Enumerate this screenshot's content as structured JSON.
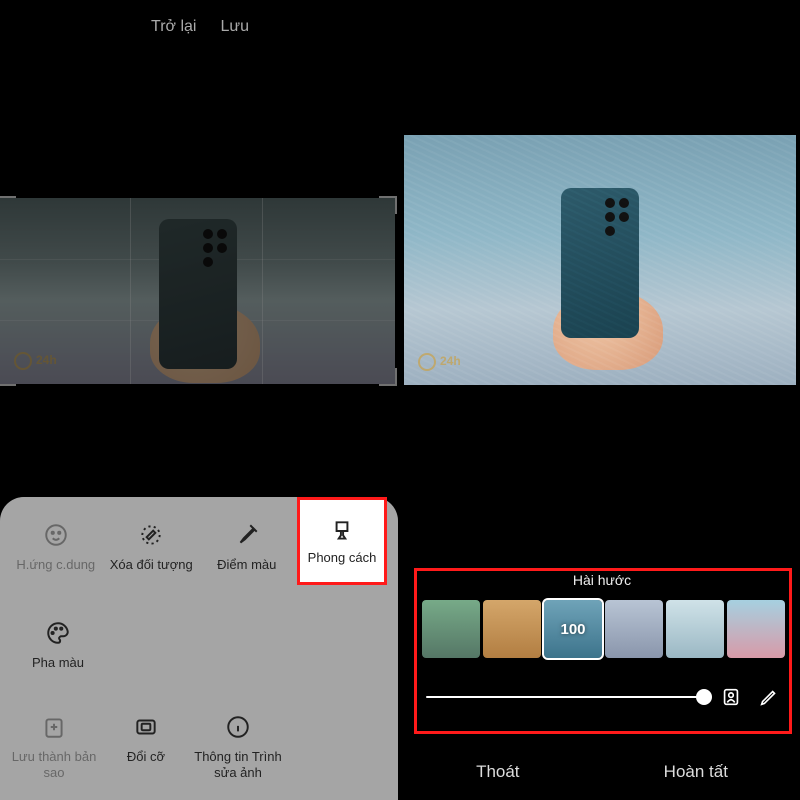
{
  "top": {
    "back": "Trở lại",
    "save": "Lưu"
  },
  "watermark": "24h",
  "tools": {
    "row1": [
      {
        "label": "H.ứng c.dung",
        "icon": "face",
        "dim": true
      },
      {
        "label": "Xóa đối tượng",
        "icon": "erase",
        "dim": false
      },
      {
        "label": "Điểm màu",
        "icon": "eyedropper",
        "dim": false
      },
      {
        "label": "Phong cách",
        "icon": "brush",
        "dim": false,
        "highlight": true
      }
    ],
    "row2": [
      {
        "label": "Pha màu",
        "icon": "palette",
        "dim": false
      }
    ],
    "row3": [
      {
        "label": "Lưu thành bản sao",
        "icon": "save-copy",
        "dim": true
      },
      {
        "label": "Đổi cỡ",
        "icon": "resize",
        "dim": false
      },
      {
        "label": "Thông tin Trình sửa ảnh",
        "icon": "info",
        "dim": false
      }
    ]
  },
  "style_panel": {
    "title": "Hài hước",
    "selected_value": "100",
    "selected_index": 2,
    "bottom": {
      "exit": "Thoát",
      "done": "Hoàn tất"
    }
  }
}
